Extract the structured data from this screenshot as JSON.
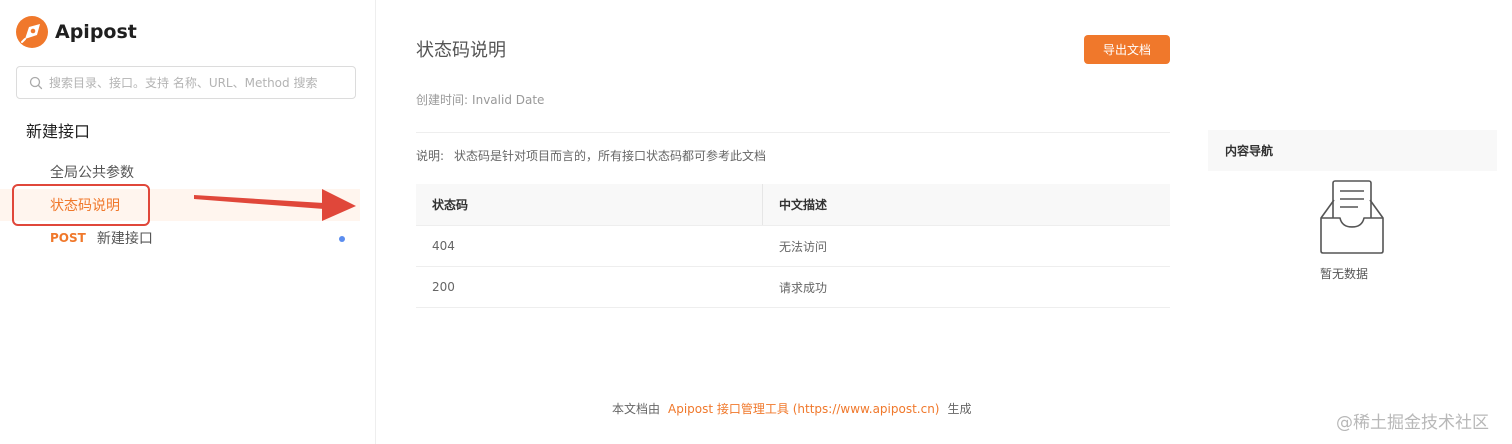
{
  "app": {
    "name": "Apipost",
    "brand_color": "#f0782b"
  },
  "sidebar": {
    "search_placeholder": "搜索目录、接口。支持 名称、URL、Method 搜索",
    "section_title": "新建接口",
    "items": [
      {
        "label": "全局公共参数"
      },
      {
        "label": "状态码说明",
        "active": true
      },
      {
        "method": "POST",
        "label": "新建接口"
      }
    ]
  },
  "main": {
    "title": "状态码说明",
    "export_button": "导出文档",
    "created_label": "创建时间:",
    "created_value": "Invalid Date",
    "desc_label": "说明:",
    "desc_text": "状态码是针对项目而言的，所有接口状态码都可参考此文档",
    "table": {
      "headers": [
        "状态码",
        "中文描述"
      ],
      "rows": [
        [
          "404",
          "无法访问"
        ],
        [
          "200",
          "请求成功"
        ]
      ]
    },
    "footer": {
      "prefix": "本文档由",
      "link": "Apipost 接口管理工具 (https://www.apipost.cn)",
      "suffix": "生成"
    }
  },
  "toc": {
    "title": "内容导航",
    "empty_text": "暂无数据"
  },
  "annotation": {
    "highlight_color": "#e0473a"
  },
  "watermark": "@稀土掘金技术社区"
}
